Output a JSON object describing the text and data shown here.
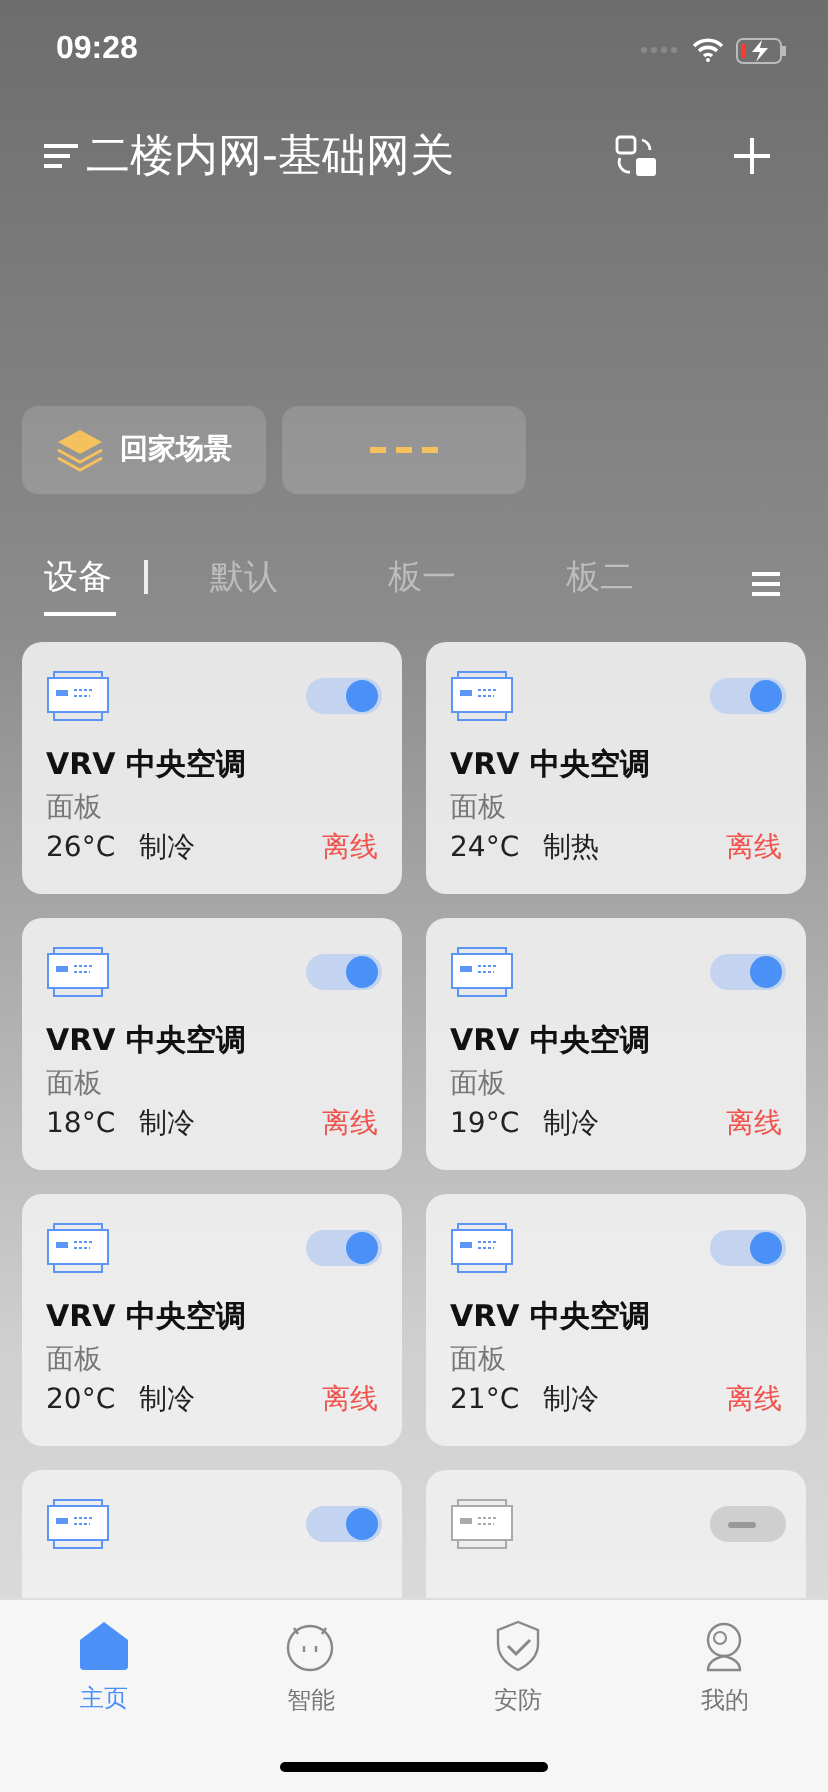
{
  "status_bar": {
    "time": "09:28"
  },
  "header": {
    "title": "二楼内网-基础网关"
  },
  "scenes": [
    {
      "kind": "scene",
      "label": "回家场景"
    },
    {
      "kind": "placeholder"
    }
  ],
  "tabs": [
    {
      "label": "设备",
      "selected": true
    },
    {
      "label": "默认",
      "selected": false
    },
    {
      "label": "板一",
      "selected": false
    },
    {
      "label": "板二",
      "selected": false
    }
  ],
  "devices": [
    {
      "name": "VRV 中央空调",
      "room": "面板",
      "temp": "26°C",
      "mode": "制冷",
      "status": "离线",
      "on": true
    },
    {
      "name": "VRV 中央空调",
      "room": "面板",
      "temp": "24°C",
      "mode": "制热",
      "status": "离线",
      "on": true
    },
    {
      "name": "VRV 中央空调",
      "room": "面板",
      "temp": "18°C",
      "mode": "制冷",
      "status": "离线",
      "on": true
    },
    {
      "name": "VRV 中央空调",
      "room": "面板",
      "temp": "19°C",
      "mode": "制冷",
      "status": "离线",
      "on": true
    },
    {
      "name": "VRV 中央空调",
      "room": "面板",
      "temp": "20°C",
      "mode": "制冷",
      "status": "离线",
      "on": true
    },
    {
      "name": "VRV 中央空调",
      "room": "面板",
      "temp": "21°C",
      "mode": "制冷",
      "status": "离线",
      "on": true
    },
    {
      "on": true
    },
    {
      "on": false
    }
  ],
  "tab_bar": [
    {
      "label": "主页",
      "kind": "home",
      "selected": true
    },
    {
      "label": "智能",
      "kind": "smart",
      "selected": false
    },
    {
      "label": "安防",
      "kind": "security",
      "selected": false
    },
    {
      "label": "我的",
      "kind": "profile",
      "selected": false
    }
  ]
}
